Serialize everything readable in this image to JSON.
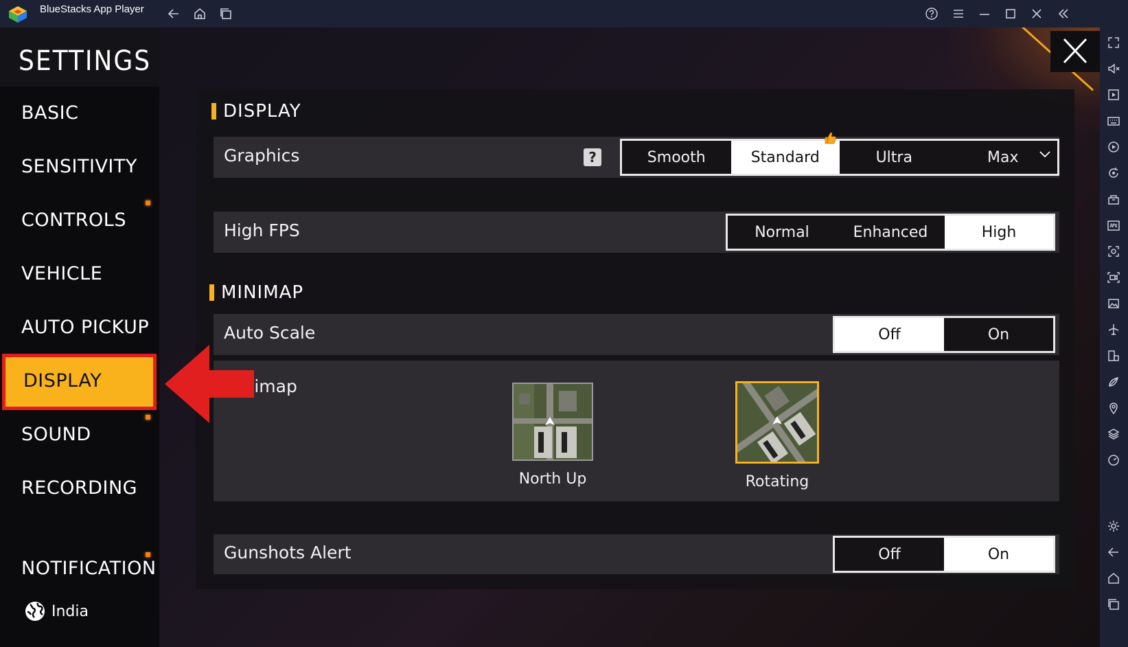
{
  "window": {
    "app_title": "BlueStacks App Player",
    "nav_icons": [
      "back-arrow-icon",
      "home-icon",
      "recent-apps-icon"
    ],
    "controls": [
      "help-icon",
      "menu-icon",
      "minimize-icon",
      "maximize-icon",
      "close-icon",
      "collapse-sidebar-icon"
    ]
  },
  "toolbar": {
    "icons": [
      "fullscreen-icon",
      "volume-icon",
      "media-manager-icon",
      "keyboard-icon",
      "macro-icon",
      "rotate-icon",
      "multi-instance-icon",
      "apk-install-icon",
      "screenshot-icon",
      "record-icon",
      "gallery-icon",
      "airplane-icon",
      "multi-window-icon",
      "eco-mode-icon",
      "location-icon",
      "layers-icon",
      "speed-icon",
      "settings-icon",
      "back-icon",
      "home-icon",
      "recents-icon"
    ]
  },
  "settings": {
    "title": "SETTINGS",
    "nav": [
      {
        "label": "BASIC",
        "dot": false,
        "active": false
      },
      {
        "label": "SENSITIVITY",
        "dot": false,
        "active": false
      },
      {
        "label": "CONTROLS",
        "dot": true,
        "active": false
      },
      {
        "label": "VEHICLE",
        "dot": false,
        "active": false
      },
      {
        "label": "AUTO PICKUP",
        "dot": false,
        "active": false
      },
      {
        "label": "DISPLAY",
        "dot": false,
        "active": true
      },
      {
        "label": "SOUND",
        "dot": true,
        "active": false
      },
      {
        "label": "RECORDING",
        "dot": false,
        "active": false
      },
      {
        "label": "NOTIFICATION",
        "dot": true,
        "active": false
      }
    ],
    "region": "India"
  },
  "display": {
    "section_title": "DISPLAY",
    "graphics": {
      "label": "Graphics",
      "help": "?",
      "options": [
        "Smooth",
        "Standard",
        "Ultra",
        "Max"
      ],
      "selected": "Standard"
    },
    "high_fps": {
      "label": "High FPS",
      "options": [
        "Normal",
        "Enhanced",
        "High"
      ],
      "selected": "High"
    }
  },
  "minimap": {
    "section_title": "MINIMAP",
    "auto_scale": {
      "label": "Auto Scale",
      "options": [
        "Off",
        "On"
      ],
      "selected": "Off"
    },
    "minimap_mode": {
      "label": "Minimap",
      "options": [
        {
          "caption": "North Up",
          "selected": false
        },
        {
          "caption": "Rotating",
          "selected": true
        }
      ]
    }
  },
  "gunshots_alert": {
    "label": "Gunshots Alert",
    "options": [
      "Off",
      "On"
    ],
    "selected": "On"
  },
  "colors": {
    "accent": "#f9b21c",
    "highlight_border": "#e21f1f",
    "arrow": "#e21f1f",
    "titlebar": "#1c2134"
  }
}
